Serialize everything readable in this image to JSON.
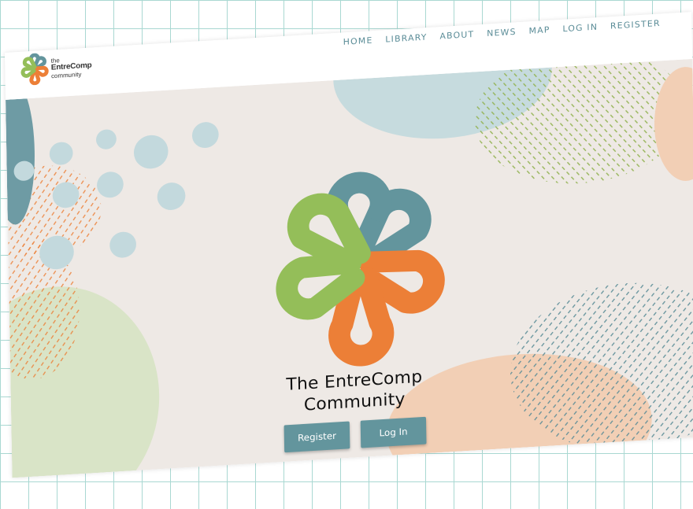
{
  "header": {
    "logo": {
      "line1": "the",
      "line2": "EntreComp",
      "line3": "community"
    },
    "nav": [
      {
        "label": "HOME"
      },
      {
        "label": "LIBRARY"
      },
      {
        "label": "ABOUT"
      },
      {
        "label": "NEWS"
      },
      {
        "label": "MAP"
      },
      {
        "label": "LOG IN"
      },
      {
        "label": "REGISTER"
      }
    ]
  },
  "hero": {
    "title_line1": "The EntreComp",
    "title_line2": "Community",
    "register_label": "Register",
    "login_label": "Log In"
  },
  "colors": {
    "teal": "#63959d",
    "green": "#94be59",
    "orange": "#ec7f37",
    "hero_background": "#eee9e5",
    "nav_text": "#5a8c97"
  }
}
